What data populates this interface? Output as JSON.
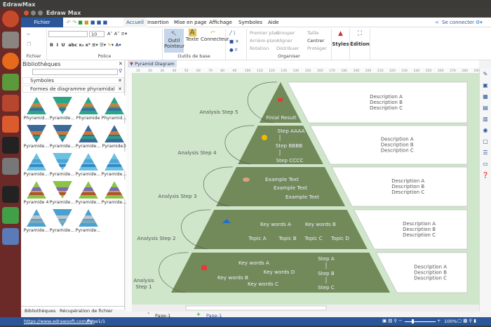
{
  "os": {
    "title": "EdrawMax"
  },
  "window": {
    "title": "Edraw Max"
  },
  "menu": {
    "file": "Fichier",
    "tabs": [
      "Accueil",
      "Insertion",
      "Mise en page",
      "Affichage",
      "Symboles",
      "Aide"
    ],
    "connect": "Se connecter"
  },
  "ribbon": {
    "groups": {
      "fichier": "Fichier",
      "police": "Police",
      "outils": "Outils de base",
      "organiser": "Organiser"
    },
    "font_size": "10",
    "pointer": [
      "Outil",
      "Pointeur"
    ],
    "text": "Texte",
    "connector": "Connecteur",
    "arrange": [
      "Premier plan",
      "Arrière-plan",
      "Rotation",
      "Grouper",
      "Aligner",
      "Distribuer",
      "Taille",
      "Centrer",
      "Protéger"
    ],
    "styles": "Styles",
    "edition": "Édition"
  },
  "library": {
    "title": "Bibliothèques",
    "sections": [
      "Symboles",
      "Formes de diagramme phyramidal"
    ],
    "shapes": [
      "Phyramid...",
      "Pyramide...",
      "Phyramide",
      "Phyramid...",
      "Pyramide...",
      "Pyramide...",
      "Pyramide...",
      "Pyramide3",
      "Pyramide...",
      "Pyramide...",
      "Pyramide...",
      "Pyramide...",
      "Pyramide 4",
      "Pyramide...",
      "Pyramide...",
      "Pyramide...",
      "Pyramide...",
      "Pyramide...",
      "Pyramide..."
    ],
    "bottom_tabs": [
      "Bibliothèques",
      "Récupération de fichier"
    ]
  },
  "document": {
    "tab": "Pyramid Diagram",
    "ruler": [
      "10",
      "20",
      "30",
      "40",
      "50",
      "60",
      "70",
      "80",
      "90",
      "100",
      "110",
      "120",
      "130",
      "140",
      "150",
      "160",
      "170",
      "180",
      "190",
      "200",
      "210",
      "220",
      "230",
      "240",
      "250",
      "260",
      "270",
      "280",
      "290"
    ]
  },
  "diagram": {
    "steps": [
      "Analysis Step 5",
      "Analysis Step 4",
      "Analysis Step 3",
      "Analysis Step 2",
      "Analysis",
      "Step 1"
    ],
    "l5": "Finial Result",
    "l4": [
      "Step AAAA",
      "Step BBBB",
      "Step CCCC"
    ],
    "l3": [
      "Example Text",
      "Example Text",
      "Example Text"
    ],
    "l2": [
      "Key words A",
      "Key words B",
      "Topic A",
      "Topic B",
      "Topic C",
      "Topic D"
    ],
    "l1": [
      "Key words A",
      "Key words D",
      "Key words B",
      "Key words C",
      "Step A",
      "Step B",
      "Step C"
    ],
    "desc": [
      "Description A",
      "Description B",
      "Description C"
    ],
    "colors": {
      "bg": "#cfe6cb",
      "layer": "#728a5a",
      "box": "#ffffff"
    }
  },
  "pages": {
    "current": "Page-1",
    "tab": "Page-1",
    "emp": "emp"
  },
  "status": {
    "url": "https://www.edrawsoft.com/fr/",
    "page": "Page1/1",
    "zoom": "100%"
  }
}
